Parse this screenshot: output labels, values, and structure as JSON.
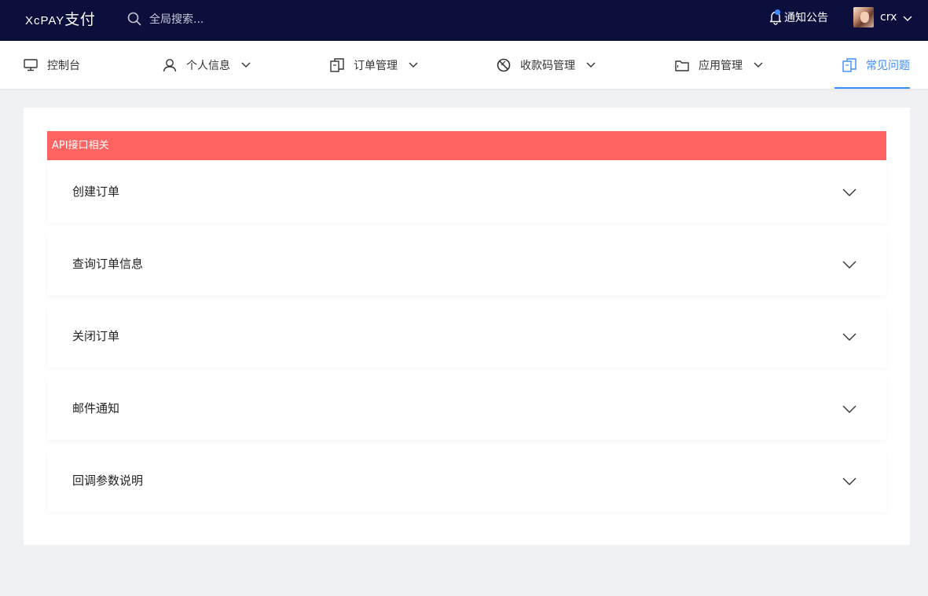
{
  "topbar": {
    "logo_latin": "XcPAY",
    "logo_cn": "支付",
    "search_placeholder": "全局搜索...",
    "notice_label": "通知公告",
    "user_name": "crx",
    "icons": {
      "search": "search-icon",
      "bell": "bell-icon",
      "chevron": "chevron-down-icon"
    }
  },
  "nav": {
    "items": [
      {
        "label": "控制台",
        "icon": "monitor-icon",
        "has_dropdown": false
      },
      {
        "label": "个人信息",
        "icon": "user-icon",
        "has_dropdown": true
      },
      {
        "label": "订单管理",
        "icon": "copy-icon",
        "has_dropdown": true
      },
      {
        "label": "收款码管理",
        "icon": "block-icon",
        "has_dropdown": true
      },
      {
        "label": "应用管理",
        "icon": "folder-icon",
        "has_dropdown": true
      },
      {
        "label": "常见问题",
        "icon": "copy-icon",
        "has_dropdown": false,
        "active": true
      }
    ]
  },
  "section": {
    "title": "API接口相关",
    "items": [
      {
        "title": "创建订单"
      },
      {
        "title": "查询订单信息"
      },
      {
        "title": "关闭订单"
      },
      {
        "title": "邮件通知"
      },
      {
        "title": "回调参数说明"
      }
    ]
  },
  "colors": {
    "topbar_bg": "#0c0f3b",
    "accent": "#3b8cff",
    "section_header_bg": "#ff6362",
    "page_bg": "#f0f1f5"
  }
}
